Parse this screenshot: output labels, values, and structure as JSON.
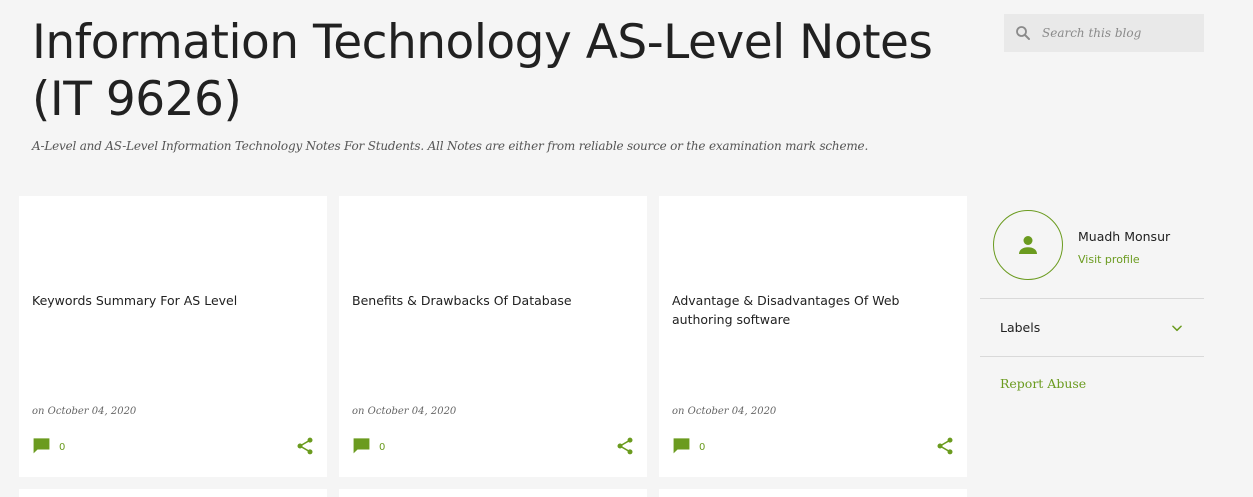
{
  "header": {
    "title": "Information Technology AS-Level Notes (IT 9626)",
    "description": "A-Level and AS-Level Information Technology Notes For Students. All Notes are either from reliable source or the examination mark scheme."
  },
  "search": {
    "placeholder": "Search this blog",
    "value": ""
  },
  "posts": [
    {
      "title": "Keywords Summary For AS Level",
      "date": "on October 04, 2020",
      "comments": "0"
    },
    {
      "title": "Benefits & Drawbacks Of Database",
      "date": "on October 04, 2020",
      "comments": "0"
    },
    {
      "title": "Advantage & Disadvantages Of Web authoring software",
      "date": "on October 04, 2020",
      "comments": "0"
    }
  ],
  "sidebar": {
    "profile_name": "Muadh Monsur",
    "visit_profile": "Visit profile",
    "labels_heading": "Labels",
    "report_abuse": "Report Abuse"
  },
  "colors": {
    "accent": "#6b9b1f",
    "background": "#f5f5f5",
    "card": "#ffffff"
  },
  "icons": [
    "search-icon",
    "comment-icon",
    "share-icon",
    "person-icon",
    "chevron-down-icon"
  ]
}
